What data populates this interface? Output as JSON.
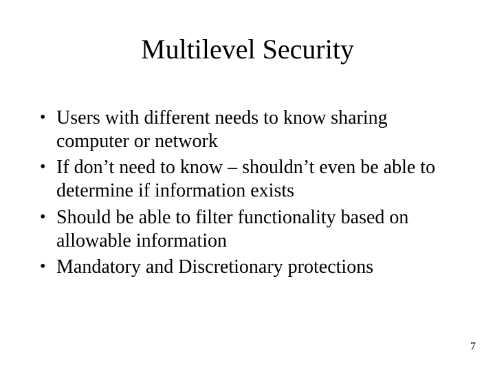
{
  "title": "Multilevel Security",
  "bullets": [
    "Users with different needs to know sharing computer or network",
    "If don’t need to know – shouldn’t even be able to determine if information exists",
    "Should be able to filter functionality based on allowable information",
    "Mandatory and Discretionary protections"
  ],
  "page_number": "7"
}
